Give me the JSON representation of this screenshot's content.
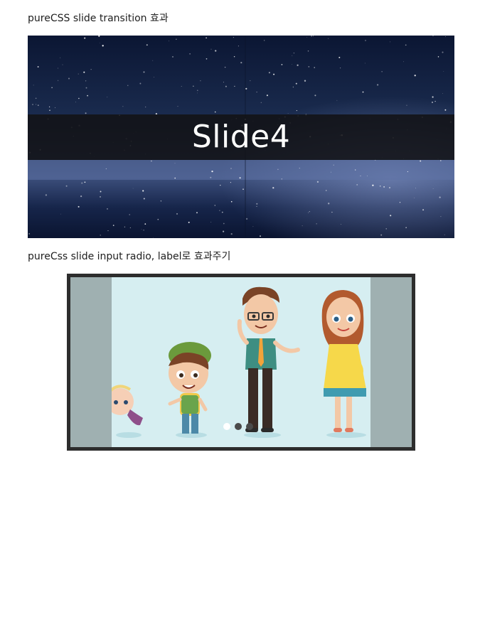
{
  "section1": {
    "heading": "pureCSS slide transition 효과",
    "slide_caption": "Slide4"
  },
  "section2": {
    "heading": "pureCss slide input radio, label로 효과주기",
    "dots": [
      {
        "state": "active"
      },
      {
        "state": "inactive"
      },
      {
        "state": "inactive"
      }
    ],
    "active_index": 0
  },
  "colors": {
    "caption_band": "#121216",
    "slider_border": "#2d2d2d",
    "slide_side_panel": "#9fb0b1",
    "slide_background": "#d6eef1",
    "dot_active": "#ffffff",
    "dot_inactive": "#4a4a4a"
  }
}
